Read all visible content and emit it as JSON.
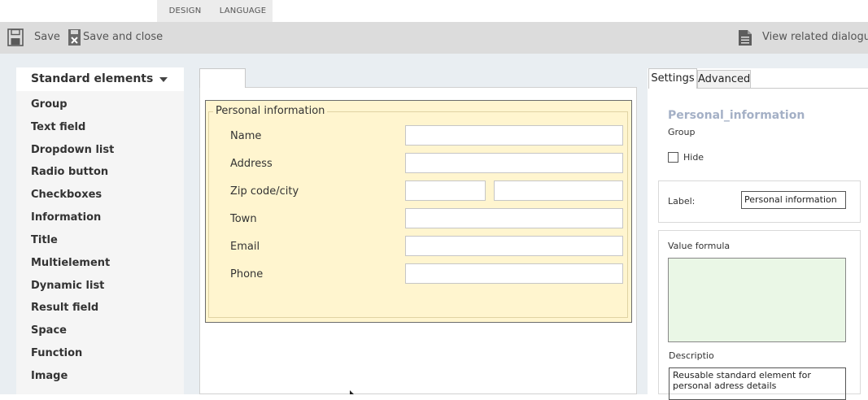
{
  "tabs": [
    {
      "label": "DESIGN"
    },
    {
      "label": "LANGUAGE"
    }
  ],
  "toolbar": {
    "save_label": "Save",
    "save_close_label": "Save and close",
    "view_related_label": "View related dialogue"
  },
  "palette": {
    "header": "Standard elements",
    "items": [
      {
        "label": "Group"
      },
      {
        "label": "Text field"
      },
      {
        "label": "Dropdown list"
      },
      {
        "label": "Radio button"
      },
      {
        "label": "Checkboxes"
      },
      {
        "label": "Information"
      },
      {
        "label": "Title"
      },
      {
        "label": "Multielement"
      },
      {
        "label": "Dynamic list"
      },
      {
        "label": "Result field"
      },
      {
        "label": "Space"
      },
      {
        "label": "Function"
      },
      {
        "label": "Image"
      }
    ]
  },
  "form": {
    "group_title": "Personal information",
    "fields": [
      {
        "label": "Name",
        "value": ""
      },
      {
        "label": "Address",
        "value": ""
      },
      {
        "label": "Zip code/city",
        "value": ""
      },
      {
        "label": "Town",
        "value": ""
      },
      {
        "label": "Email",
        "value": ""
      },
      {
        "label": "Phone",
        "value": ""
      }
    ]
  },
  "properties": {
    "tabs": [
      {
        "label": "Settings"
      },
      {
        "label": "Advanced"
      }
    ],
    "element_name": "Personal_information",
    "element_type": "Group",
    "hide_label": "Hide",
    "hide_checked": false,
    "label_caption": "Label:",
    "label_value": "Personal information",
    "value_formula_caption": "Value formula",
    "value_formula": "",
    "description_caption": "Descriptio",
    "description_value": "Reusable standard element for personal adress details"
  },
  "colors": {
    "toolbar_bg": "#dcdcdc",
    "group_bg": "#fff5cf",
    "formula_bg": "#eaf7e6",
    "element_name": "#a4b0c6"
  },
  "icons": {
    "save": "floppy-disk-icon",
    "save_close": "floppy-disk-close-icon",
    "view_related": "document-icon",
    "palette_toggle": "caret-down-icon"
  }
}
